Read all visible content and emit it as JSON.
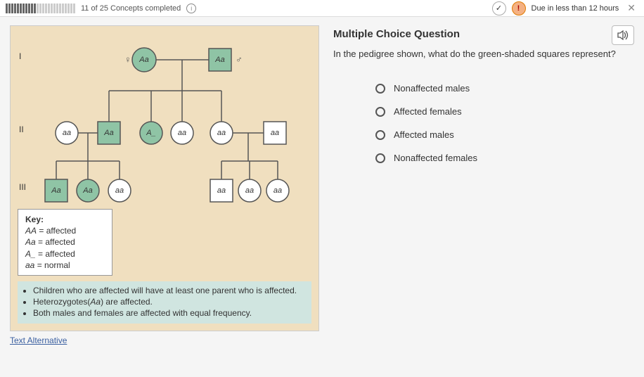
{
  "top": {
    "progress": "11 of 25 Concepts completed",
    "due": "Due in less than 12 hours"
  },
  "pedigree": {
    "gen_labels": {
      "I": "I",
      "II": "II",
      "III": "III"
    },
    "genotypes": {
      "I_mother": "Aa",
      "I_father": "Aa",
      "II_1": "aa",
      "II_2": "Aa",
      "II_3": "A_",
      "II_4": "aa",
      "II_5": "aa",
      "II_6": "aa",
      "III_1": "Aa",
      "III_2": "Aa",
      "III_3": "aa",
      "III_4": "aa",
      "III_5": "aa",
      "III_6": "aa"
    },
    "key": {
      "title": "Key:",
      "l1_left": "AA",
      "l1_right": " = affected",
      "l2_left": "Aa",
      "l2_right": " = affected",
      "l3_left": "A_",
      "l3_right": " = affected",
      "l4_left": "aa",
      "l4_right": " = normal"
    },
    "bullets": {
      "b1": "Children who are affected will have at least one parent who is affected.",
      "b2_a": "Heterozygotes(",
      "b2_b": "Aa",
      "b2_c": ") are affected.",
      "b3": "Both males and females are affected with equal frequency."
    },
    "text_alt": "Text Alternative"
  },
  "question": {
    "heading": "Multiple Choice Question",
    "prompt": "In the pedigree shown, what do the green-shaded squares represent?",
    "options": {
      "o1": "Nonaffected males",
      "o2": "Affected females",
      "o3": "Affected males",
      "o4": "Nonaffected females"
    }
  }
}
